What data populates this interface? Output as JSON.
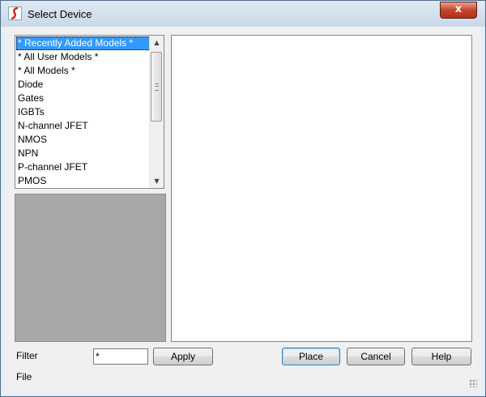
{
  "window": {
    "title": "Select Device",
    "close_glyph": "x",
    "app_icon": "spice-logo-icon"
  },
  "device_list": {
    "items": [
      {
        "label": "* Recently Added Models *",
        "selected": true
      },
      {
        "label": "* All User Models *",
        "selected": false
      },
      {
        "label": "* All Models *",
        "selected": false
      },
      {
        "label": "Diode",
        "selected": false
      },
      {
        "label": "Gates",
        "selected": false
      },
      {
        "label": "IGBTs",
        "selected": false
      },
      {
        "label": "N-channel JFET",
        "selected": false
      },
      {
        "label": "NMOS",
        "selected": false
      },
      {
        "label": "NPN",
        "selected": false
      },
      {
        "label": "P-channel JFET",
        "selected": false
      },
      {
        "label": "PMOS",
        "selected": false
      }
    ],
    "scroll_up_glyph": "▲",
    "scroll_down_glyph": "▼"
  },
  "filter": {
    "label": "Filter",
    "value": "*"
  },
  "file": {
    "label": "File"
  },
  "buttons": {
    "apply": "Apply",
    "place": "Place",
    "cancel": "Cancel",
    "help": "Help"
  },
  "colors": {
    "selection": "#3399ff",
    "preview_background": "#a8a8a8",
    "close_button": "#c4452e"
  }
}
